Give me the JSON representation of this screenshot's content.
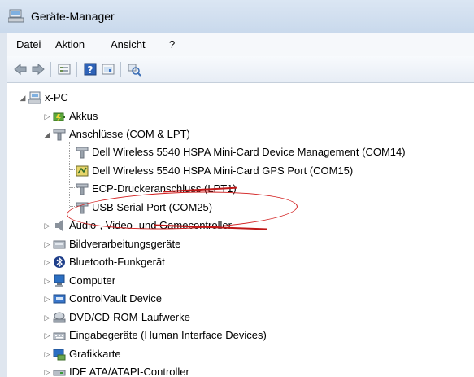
{
  "window": {
    "title": "Geräte-Manager"
  },
  "menu": {
    "items": [
      "Datei",
      "Aktion",
      "Ansicht",
      "?"
    ]
  },
  "toolbar": {
    "buttons": [
      "back-arrow-icon",
      "forward-arrow-icon",
      "properties-icon",
      "help-icon",
      "view-icon",
      "scan-hardware-icon"
    ]
  },
  "tree": {
    "root": "x-PC",
    "akkus": "Akkus",
    "anschluesse": "Anschlüsse (COM & LPT)",
    "ports": [
      "Dell Wireless 5540 HSPA Mini-Card Device Management (COM14)",
      "Dell Wireless 5540 HSPA Mini-Card GPS Port (COM15)",
      "ECP-Druckeranschluss (LPT1)",
      "USB Serial Port (COM25)"
    ],
    "categories": [
      "Audio-, Video- und Gamecontroller",
      "Bildverarbeitungsgeräte",
      "Bluetooth-Funkgerät",
      "Computer",
      "ControlVault Device",
      "DVD/CD-ROM-Laufwerke",
      "Eingabegeräte (Human Interface Devices)",
      "Grafikkarte",
      "IDE ATA/ATAPI-Controller"
    ]
  },
  "colors": {
    "annotation": "#d21f1f",
    "selection_window": "#dfe6ef"
  }
}
